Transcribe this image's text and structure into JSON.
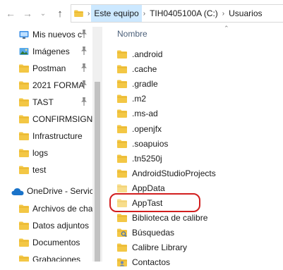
{
  "address_bar": {
    "breadcrumbs": [
      "Este equipo",
      "TIH0405100A (C:)",
      "Usuarios"
    ]
  },
  "sidebar": {
    "quick_access": [
      {
        "label": "Mis nuevos c",
        "icon": "desktop-folder-icon",
        "pinned": true
      },
      {
        "label": "Imágenes",
        "icon": "pictures-folder-icon",
        "pinned": true
      },
      {
        "label": "Postman",
        "icon": "folder-icon",
        "pinned": true
      },
      {
        "label": "2021 FORMA",
        "icon": "folder-icon",
        "pinned": true
      },
      {
        "label": "TAST",
        "icon": "folder-icon",
        "pinned": true
      },
      {
        "label": "CONFIRMSIGN-",
        "icon": "folder-icon",
        "pinned": false
      },
      {
        "label": "Infrastructure",
        "icon": "folder-icon",
        "pinned": false
      },
      {
        "label": "logs",
        "icon": "folder-icon",
        "pinned": false
      },
      {
        "label": "test",
        "icon": "folder-icon",
        "pinned": false
      }
    ],
    "onedrive": {
      "label": "OneDrive - Servic",
      "icon": "onedrive-cloud-icon"
    },
    "onedrive_items": [
      {
        "label": "Archivos de cha",
        "icon": "folder-icon"
      },
      {
        "label": "Datos adjuntos",
        "icon": "folder-icon"
      },
      {
        "label": "Documentos",
        "icon": "folder-icon"
      },
      {
        "label": "Grabaciones",
        "icon": "folder-icon"
      }
    ]
  },
  "file_list": {
    "column_header": "Nombre",
    "items": [
      {
        "name": ".android",
        "icon": "folder-icon"
      },
      {
        "name": ".cache",
        "icon": "folder-icon"
      },
      {
        "name": ".gradle",
        "icon": "folder-icon"
      },
      {
        "name": ".m2",
        "icon": "folder-icon"
      },
      {
        "name": ".ms-ad",
        "icon": "folder-icon"
      },
      {
        "name": ".openjfx",
        "icon": "folder-icon"
      },
      {
        "name": ".soapuios",
        "icon": "folder-icon"
      },
      {
        "name": ".tn5250j",
        "icon": "folder-icon"
      },
      {
        "name": "AndroidStudioProjects",
        "icon": "folder-icon"
      },
      {
        "name": "AppData",
        "icon": "folder-faded-icon"
      },
      {
        "name": "AppTast",
        "icon": "folder-faded-icon",
        "highlighted": true
      },
      {
        "name": "Biblioteca de calibre",
        "icon": "folder-icon"
      },
      {
        "name": "Búsquedas",
        "icon": "search-folder-icon"
      },
      {
        "name": "Calibre Library",
        "icon": "folder-icon"
      },
      {
        "name": "Contactos",
        "icon": "contacts-folder-icon"
      }
    ]
  },
  "colors": {
    "folder": "#f3c745",
    "folder_dark": "#e0a920",
    "address_highlight": "#cce8ff",
    "annotation_ring": "#d21f1f",
    "onedrive": "#1a73c9"
  }
}
